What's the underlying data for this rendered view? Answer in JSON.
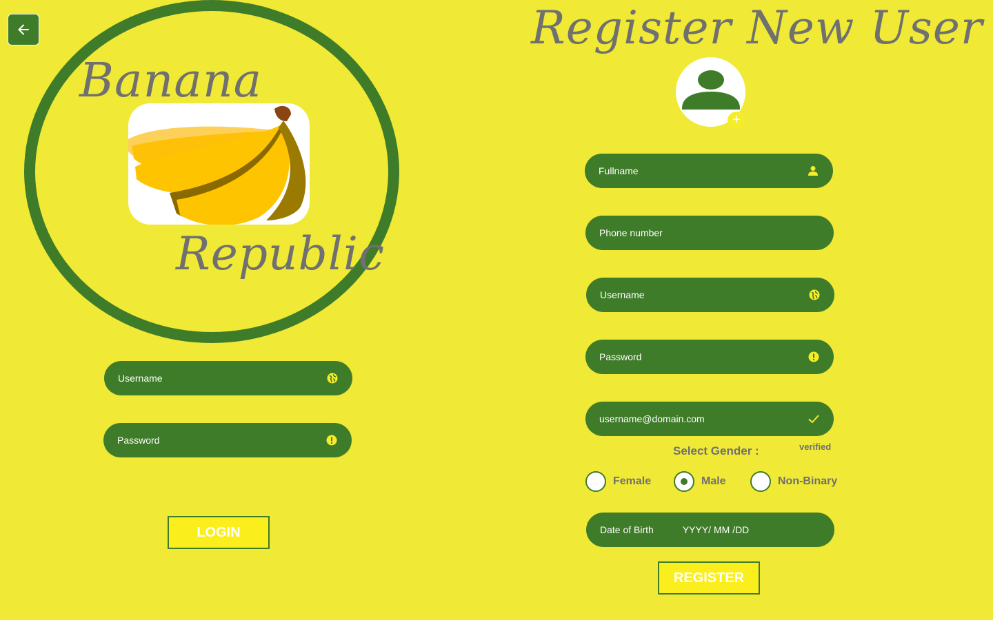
{
  "colors": {
    "background": "#f0e935",
    "accent_green": "#3f7c2a",
    "text_gray": "#707070",
    "button_yellow": "#fbee1d"
  },
  "icons": {
    "back": "arrow-left-icon",
    "profile": "user-silhouette-icon",
    "add_photo": "plus-icon",
    "fullname": "person-icon",
    "username": "globe-icon",
    "password": "alert-circle-icon",
    "email": "check-icon"
  },
  "login": {
    "brand_line1": "Banana",
    "brand_line2": "Republic",
    "username_placeholder": "Username",
    "password_placeholder": "Password",
    "login_button": "LOGIN"
  },
  "register": {
    "title": "Register New User",
    "add_photo_symbol": "+",
    "fullname_placeholder": "Fullname",
    "phone_placeholder": "Phone number",
    "username_placeholder": "Username",
    "password_placeholder": "Password",
    "email_value": "username@domain.com",
    "email_status": "verified",
    "gender_label": "Select Gender :",
    "gender_options": [
      "Female",
      "Male",
      "Non-Binary"
    ],
    "gender_selected": "Male",
    "dob_label": "Date of Birth",
    "dob_placeholder": "YYYY/ MM /DD",
    "register_button": "REGISTER"
  }
}
